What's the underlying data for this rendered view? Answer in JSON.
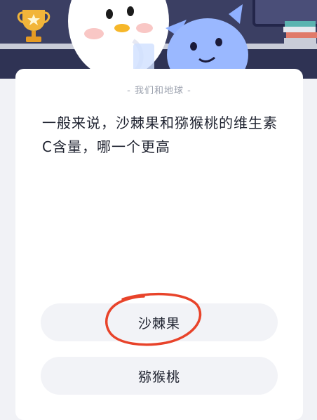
{
  "header": {
    "subtitle": "- 我们和地球 -"
  },
  "question": {
    "text": "一般来说，沙棘果和猕猴桃的维生素C含量，哪一个更高"
  },
  "options": [
    {
      "label": "沙棘果"
    },
    {
      "label": "猕猴桃"
    }
  ],
  "colors": {
    "banner": "#3b3f63",
    "card": "#ffffff",
    "option_bg": "#f2f3f7",
    "annotation": "#e8432a"
  },
  "annotation": {
    "icon": "hand-drawn-circle-icon",
    "target": "沙棘果"
  }
}
